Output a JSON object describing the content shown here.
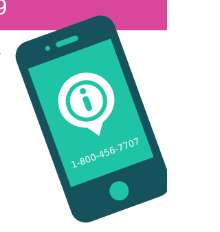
{
  "header": {
    "fragment": "9"
  },
  "side_text": {
    "fragment": "7"
  },
  "phone": {
    "number": "1-800-456-7707",
    "icon": "info-icon"
  },
  "colors": {
    "header_pink": "#d9479b",
    "phone_body": "#16525c",
    "screen": "#1fc4a6",
    "pin": "#ffffff",
    "info_glyph": "#1fc4a6"
  }
}
